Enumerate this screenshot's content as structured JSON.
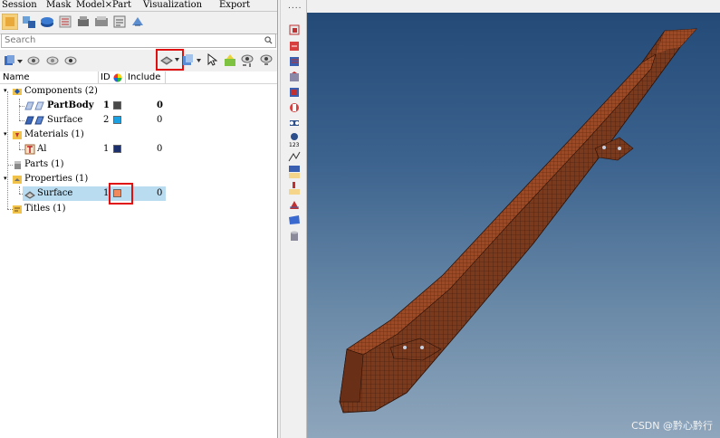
{
  "menu_tabs": [
    "Session",
    "Mask",
    "Model",
    "Part",
    "Visualization",
    "Export"
  ],
  "model_tab_close": "×",
  "search": {
    "placeholder": "Search"
  },
  "columns": {
    "name": "Name",
    "id": "ID",
    "include": "Include"
  },
  "tree": [
    {
      "label": "Components (2)",
      "level": 0,
      "icon": "components-icon"
    },
    {
      "label": "PartBody",
      "level": 1,
      "id": "1",
      "color": "#4a4a4a",
      "include": "0",
      "bold": true,
      "icon": "partbody-component-icon"
    },
    {
      "label": "Surface",
      "level": 1,
      "id": "2",
      "color": "#1ba1e2",
      "include": "0",
      "icon": "surface-component-icon"
    },
    {
      "label": "Materials (1)",
      "level": 0,
      "icon": "materials-icon"
    },
    {
      "label": "Al",
      "level": 1,
      "id": "1",
      "color": "#1a2f6b",
      "include": "0",
      "icon": "material-icon"
    },
    {
      "label": "Parts (1)",
      "level": 0,
      "icon": "parts-icon"
    },
    {
      "label": "Properties (1)",
      "level": 0,
      "icon": "properties-icon"
    },
    {
      "label": "Surface",
      "level": 1,
      "id": "1",
      "color": "#f08a5d",
      "include": "0",
      "selected": true,
      "icon": "property-icon"
    },
    {
      "label": "Titles (1)",
      "level": 0,
      "icon": "titles-icon"
    }
  ],
  "watermark": "CSDN @黔心黔行",
  "colors": {
    "highlight_box": "#e01010",
    "selection": "#b9dcf1",
    "viewport_top": "#244a78",
    "viewport_bottom": "#8fa6bc",
    "model": "#7a3a1e"
  }
}
